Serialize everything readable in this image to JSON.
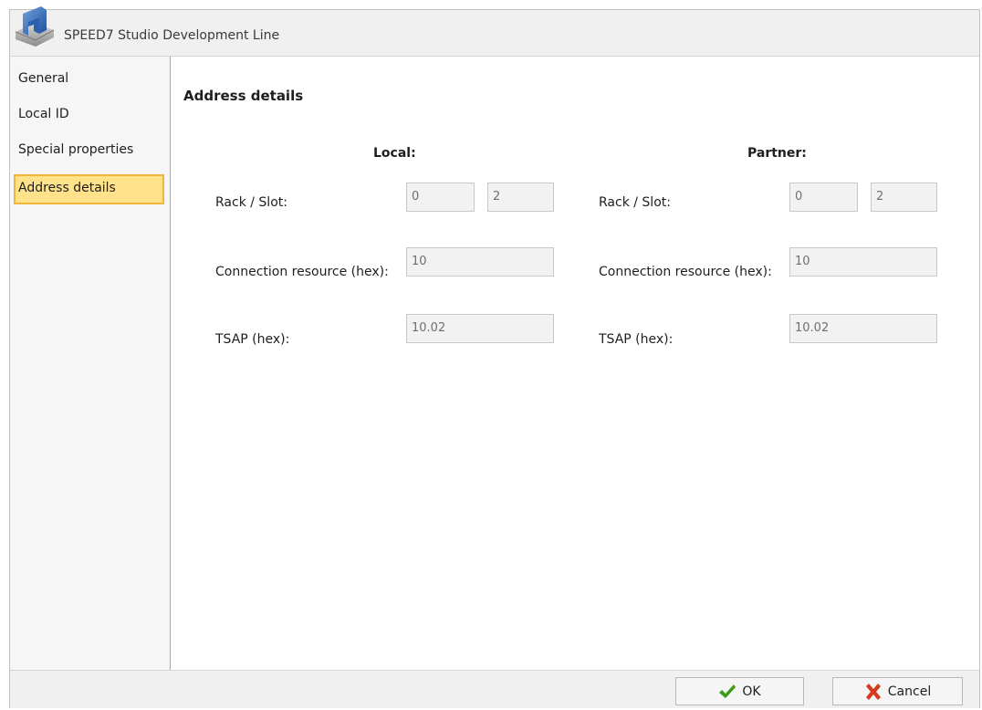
{
  "window": {
    "title": "SPEED7 Studio Development Line",
    "icon": "speed7-logo-icon"
  },
  "sidebar": {
    "items": [
      {
        "label": "General"
      },
      {
        "label": "Local ID"
      },
      {
        "label": "Special properties"
      },
      {
        "label": "Address details",
        "selected": true
      }
    ]
  },
  "main": {
    "heading": "Address details",
    "local": {
      "header": "Local:",
      "rack_slot_label": "Rack / Slot:",
      "rack": "0",
      "slot": "2",
      "conn_label": "Connection resource (hex):",
      "conn_value": "10",
      "tsap_label": "TSAP (hex):",
      "tsap_value": "10.02"
    },
    "partner": {
      "header": "Partner:",
      "rack_slot_label": "Rack / Slot:",
      "rack": "0",
      "slot": "2",
      "conn_label": "Connection resource (hex):",
      "conn_value": "10",
      "tsap_label": "TSAP (hex):",
      "tsap_value": "10.02"
    }
  },
  "buttons": {
    "ok": {
      "label": "OK",
      "icon": "checkmark-icon",
      "color": "#3f9a18"
    },
    "cancel": {
      "label": "Cancel",
      "icon": "cross-icon",
      "color": "#d63a1c"
    }
  },
  "colors": {
    "selection_fill": "#ffe28a",
    "selection_border": "#f3b437"
  }
}
